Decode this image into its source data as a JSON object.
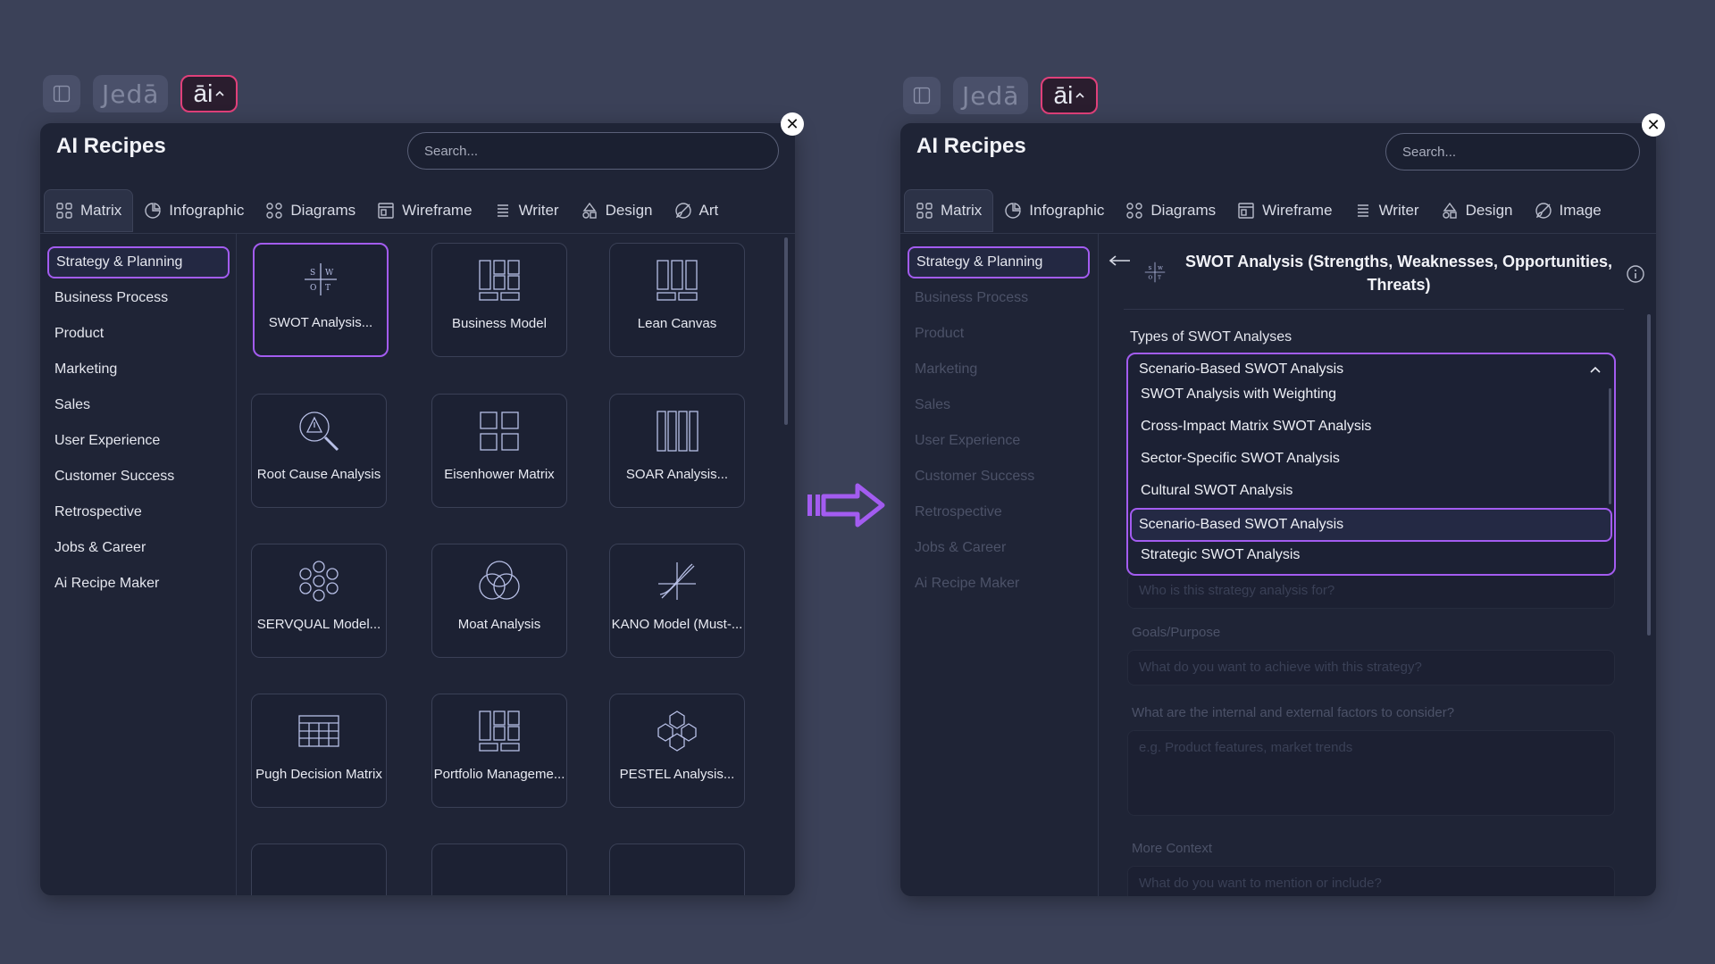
{
  "toolbar": {
    "brand": "Jedā",
    "ai_label": "āi"
  },
  "left": {
    "title": "AI Recipes",
    "search_placeholder": "Search...",
    "tabs": [
      {
        "label": "Matrix",
        "icon": "grid-icon"
      },
      {
        "label": "Infographic",
        "icon": "pie-chart-icon"
      },
      {
        "label": "Diagrams",
        "icon": "diagram-icon"
      },
      {
        "label": "Wireframe",
        "icon": "wireframe-icon"
      },
      {
        "label": "Writer",
        "icon": "writer-icon"
      },
      {
        "label": "Design",
        "icon": "shapes-icon"
      },
      {
        "label": "Art",
        "icon": "brush-icon"
      }
    ],
    "categories": [
      "Strategy & Planning",
      "Business Process",
      "Product",
      "Marketing",
      "Sales",
      "User Experience",
      "Customer Success",
      "Retrospective",
      "Jobs & Career",
      "Ai Recipe Maker"
    ],
    "cards": [
      {
        "label": "SWOT Analysis...",
        "icon": "swot-icon"
      },
      {
        "label": "Business Model",
        "icon": "business-model-icon"
      },
      {
        "label": "Lean Canvas",
        "icon": "lean-canvas-icon"
      },
      {
        "label": "Root Cause Analysis",
        "icon": "magnifier-alert-icon"
      },
      {
        "label": "Eisenhower Matrix",
        "icon": "quad-grid-icon"
      },
      {
        "label": "SOAR Analysis...",
        "icon": "columns-icon"
      },
      {
        "label": "SERVQUAL Model...",
        "icon": "flower-icon"
      },
      {
        "label": "Moat Analysis",
        "icon": "venn-icon"
      },
      {
        "label": "KANO Model (Must-...",
        "icon": "kano-icon"
      },
      {
        "label": "Pugh Decision Matrix",
        "icon": "table-icon"
      },
      {
        "label": "Portfolio Manageme...",
        "icon": "portfolio-icon"
      },
      {
        "label": "PESTEL Analysis...",
        "icon": "hexagons-icon"
      }
    ]
  },
  "right": {
    "title": "AI Recipes",
    "search_placeholder": "Search...",
    "tabs": [
      {
        "label": "Matrix",
        "icon": "grid-icon"
      },
      {
        "label": "Infographic",
        "icon": "pie-chart-icon"
      },
      {
        "label": "Diagrams",
        "icon": "diagram-icon"
      },
      {
        "label": "Wireframe",
        "icon": "wireframe-icon"
      },
      {
        "label": "Writer",
        "icon": "writer-icon"
      },
      {
        "label": "Design",
        "icon": "shapes-icon"
      },
      {
        "label": "Image",
        "icon": "brush-icon"
      }
    ],
    "categories": [
      "Strategy & Planning",
      "Business Process",
      "Product",
      "Marketing",
      "Sales",
      "User Experience",
      "Customer Success",
      "Retrospective",
      "Jobs & Career",
      "Ai Recipe Maker"
    ],
    "detail_title": "SWOT Analysis (Strengths, Weaknesses, Opportunities, Threats)",
    "types_label": "Types of SWOT Analyses",
    "selected_type": "Scenario-Based SWOT Analysis",
    "options": [
      "SWOT Analysis with Weighting",
      "Cross-Impact Matrix SWOT Analysis",
      "Sector-Specific SWOT Analysis",
      "Cultural SWOT Analysis",
      "Scenario-Based SWOT Analysis",
      "Strategic SWOT Analysis"
    ],
    "audience_placeholder": "Who is this strategy analysis for?",
    "goals_label": "Goals/Purpose",
    "goals_placeholder": "What do you want to achieve with this strategy?",
    "factors_label": "What are the internal and external factors to consider?",
    "factors_placeholder": "e.g. Product features, market trends",
    "context_label": "More Context",
    "context_placeholder": "What do you want to mention or include?"
  },
  "colors": {
    "accent": "#a35cf0",
    "ai_border": "#e0407a",
    "background": "#3b4158",
    "panel": "#1f2436"
  }
}
